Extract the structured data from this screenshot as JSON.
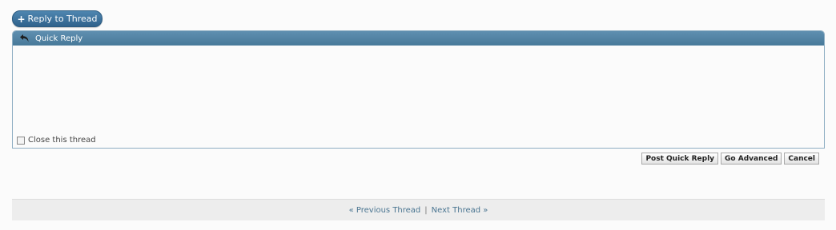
{
  "toolbar": {
    "reply_plus": "+",
    "reply_label": "Reply to Thread"
  },
  "quick_reply": {
    "title": "Quick Reply",
    "close_thread_label": "Close this thread"
  },
  "actions": {
    "post_label": "Post Quick Reply",
    "advanced_label": "Go Advanced",
    "cancel_label": "Cancel"
  },
  "thread_nav": {
    "previous_label": "« Previous Thread",
    "separator": "|",
    "next_label": "Next Thread »"
  },
  "colors": {
    "header_blue": "#477999",
    "button_blue": "#2f628c",
    "link": "#4a7591"
  }
}
